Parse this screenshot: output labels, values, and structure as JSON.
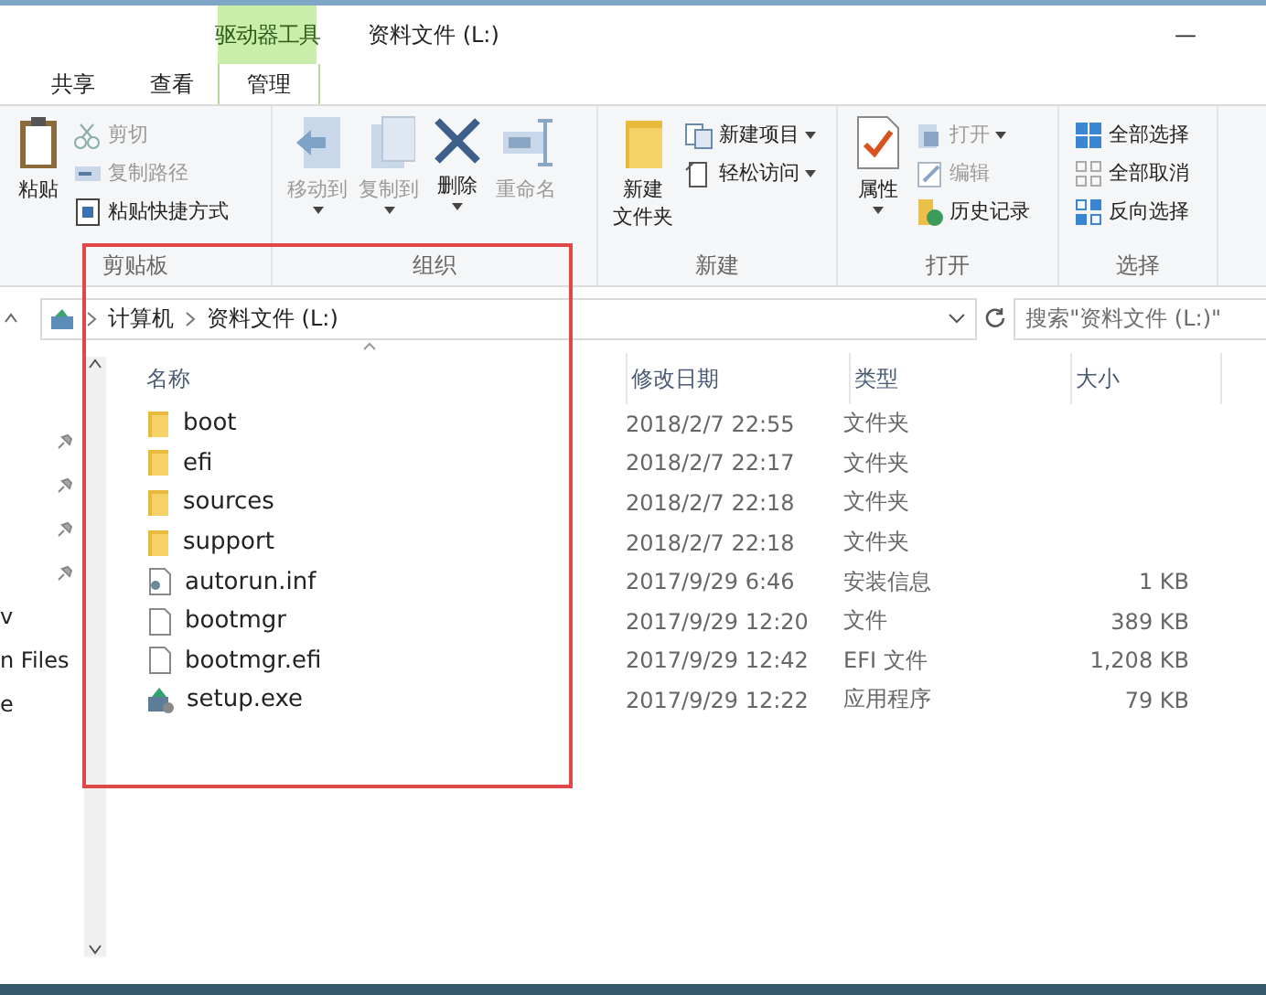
{
  "title_bar": {
    "context_tab": "驱动器工具",
    "title": "资料文件 (L:)",
    "minimize": "—"
  },
  "tabs": [
    {
      "label": "共享",
      "selected": false,
      "kind": "plain"
    },
    {
      "label": "查看",
      "selected": false,
      "kind": "plain"
    },
    {
      "label": "管理",
      "selected": false,
      "kind": "context"
    }
  ],
  "ribbon": [
    {
      "label": "剪贴板",
      "items": [
        {
          "kind": "large",
          "label": "粘贴",
          "disabled": false,
          "dropdown": false
        },
        {
          "kind": "small",
          "label": "剪切",
          "disabled": true,
          "dropdown": false
        },
        {
          "kind": "small",
          "label": "复制路径",
          "disabled": true,
          "dropdown": false
        },
        {
          "kind": "small",
          "label": "粘贴快捷方式",
          "disabled": false,
          "dropdown": false
        }
      ]
    },
    {
      "label": "组织",
      "items": [
        {
          "kind": "large",
          "label": "移动到",
          "disabled": true,
          "dropdown": true
        },
        {
          "kind": "large",
          "label": "复制到",
          "disabled": true,
          "dropdown": true
        },
        {
          "kind": "large",
          "label": "删除",
          "disabled": false,
          "dropdown": true
        },
        {
          "kind": "large",
          "label": "重命名",
          "disabled": true,
          "dropdown": false
        }
      ]
    },
    {
      "label": "新建",
      "items": [
        {
          "kind": "large",
          "lines": [
            "新建",
            "文件夹"
          ],
          "disabled": false,
          "dropdown": false
        },
        {
          "kind": "small",
          "label": "新建项目",
          "disabled": false,
          "dropdown": true
        },
        {
          "kind": "small",
          "label": "轻松访问",
          "disabled": false,
          "dropdown": true
        }
      ]
    },
    {
      "label": "打开",
      "items": [
        {
          "kind": "large",
          "label": "属性",
          "disabled": false,
          "dropdown": true
        },
        {
          "kind": "small",
          "label": "打开",
          "disabled": true,
          "dropdown": true
        },
        {
          "kind": "small",
          "label": "编辑",
          "disabled": true,
          "dropdown": false
        },
        {
          "kind": "small",
          "label": "历史记录",
          "disabled": false,
          "dropdown": false
        }
      ]
    },
    {
      "label": "选择",
      "items": [
        {
          "kind": "small",
          "label": "全部选择",
          "disabled": false,
          "dropdown": false
        },
        {
          "kind": "small",
          "label": "全部取消",
          "disabled": false,
          "dropdown": false
        },
        {
          "kind": "small",
          "label": "反向选择",
          "disabled": false,
          "dropdown": false
        }
      ]
    }
  ],
  "address": {
    "crumbs": [
      "计算机",
      "资料文件 (L:)"
    ],
    "search_placeholder": "搜索\"资料文件 (L:)\""
  },
  "nav": [
    {
      "pinned": true
    },
    {
      "pinned": true
    },
    {
      "pinned": true
    },
    {
      "pinned": true
    },
    {
      "label": "v",
      "pinned": false
    },
    {
      "label": "n Files",
      "pinned": false
    },
    {
      "label": "e",
      "pinned": false
    }
  ],
  "columns": [
    "名称",
    "修改日期",
    "类型",
    "大小"
  ],
  "rows": [
    {
      "kind": "folder",
      "name": "boot",
      "date": "2018/2/7 22:55",
      "type": "文件夹"
    },
    {
      "kind": "folder",
      "name": "efi",
      "date": "2018/2/7 22:17",
      "type": "文件夹"
    },
    {
      "kind": "folder",
      "name": "sources",
      "date": "2018/2/7 22:18",
      "type": "文件夹"
    },
    {
      "kind": "folder",
      "name": "support",
      "date": "2018/2/7 22:18",
      "type": "文件夹"
    },
    {
      "kind": "settings",
      "name": "autorun.inf",
      "date": "2017/9/29 6:46",
      "type": "安装信息",
      "size": "1 KB"
    },
    {
      "kind": "file",
      "name": "bootmgr",
      "date": "2017/9/29 12:20",
      "type": "文件",
      "size": "389 KB"
    },
    {
      "kind": "file",
      "name": "bootmgr.efi",
      "date": "2017/9/29 12:42",
      "type": "EFI 文件",
      "size": "1,208 KB"
    },
    {
      "kind": "exe",
      "name": "setup.exe",
      "date": "2017/9/29 12:22",
      "type": "应用程序",
      "size": "79 KB"
    }
  ]
}
